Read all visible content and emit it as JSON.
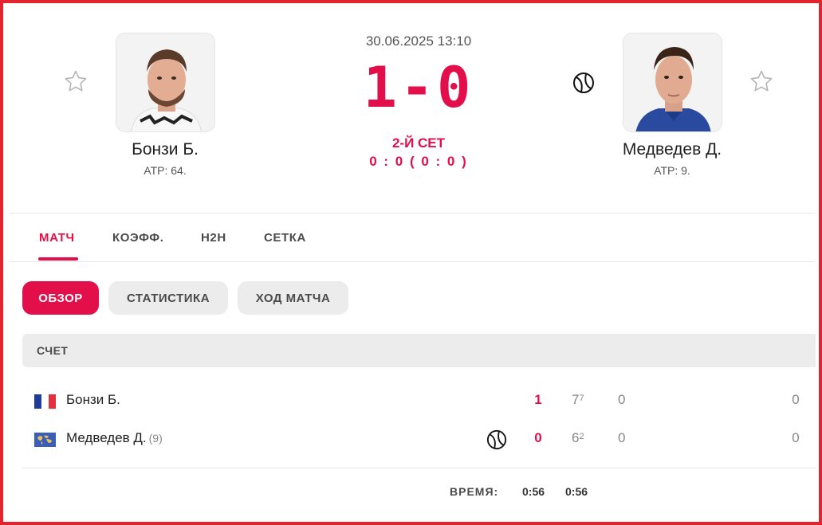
{
  "match": {
    "datetime": "30.06.2025 13:10",
    "score": "1-0",
    "set_label": "2-Й СЕТ",
    "set_score": "0 : 0 ( 0 : 0 )"
  },
  "home": {
    "name": "Бонзи Б.",
    "rank": "ATP: 64."
  },
  "away": {
    "name": "Медведев Д.",
    "rank": "ATP: 9."
  },
  "tabs": [
    {
      "label": "МАТЧ",
      "active": true
    },
    {
      "label": "КОЭФФ.",
      "active": false
    },
    {
      "label": "H2H",
      "active": false
    },
    {
      "label": "СЕТКА",
      "active": false
    }
  ],
  "subtabs": [
    {
      "label": "ОБЗОР",
      "active": true
    },
    {
      "label": "СТАТИСТИКА",
      "active": false
    },
    {
      "label": "ХОД МАТЧА",
      "active": false
    }
  ],
  "scoreboard": {
    "title": "СЧЕТ",
    "rows": [
      {
        "name": "Бонзи Б.",
        "seed": "",
        "sets": "1",
        "set1": "7",
        "set1_tb": "7",
        "set2": "0",
        "points": "0"
      },
      {
        "name": "Медведев Д.",
        "seed": "(9)",
        "sets": "0",
        "set1": "6",
        "set1_tb": "2",
        "set2": "0",
        "points": "0"
      }
    ]
  },
  "time": {
    "label": "ВРЕМЯ:",
    "total": "0:56",
    "set1": "0:56"
  },
  "icons": {
    "favorite": "star-outline-icon",
    "serve": "tennis-ball-icon",
    "home_flag": "flag-france",
    "away_flag": "flag-neutral-world"
  },
  "colors": {
    "accent": "#e20f4a",
    "frame": "#e2242f",
    "pill_bg": "#ececec"
  }
}
